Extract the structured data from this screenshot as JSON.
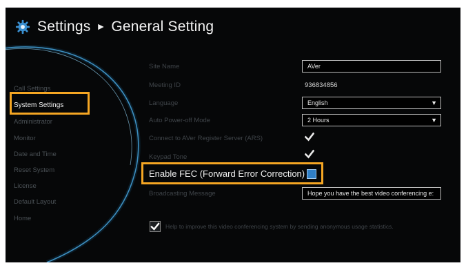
{
  "header": {
    "app_title": "Settings",
    "separator": "►",
    "page_title": "General Setting"
  },
  "sidebar": {
    "items": [
      {
        "label": "Call Settings"
      },
      {
        "label": "System Settings"
      },
      {
        "label": "Administrator"
      },
      {
        "label": "Monitor"
      },
      {
        "label": "Date and Time"
      },
      {
        "label": "Reset System"
      },
      {
        "label": "License"
      },
      {
        "label": "Default Layout"
      },
      {
        "label": "Home"
      }
    ],
    "selected_index": 1
  },
  "settings": {
    "site_name": {
      "label": "Site Name",
      "value": "AVer"
    },
    "meeting_id": {
      "label": "Meeting ID",
      "value": "936834856"
    },
    "language": {
      "label": "Language",
      "value": "English"
    },
    "auto_power_off": {
      "label": "Auto Power-off Mode",
      "value": "2 Hours"
    },
    "connect_ars": {
      "label": "Connect to AVer Register Server (ARS)",
      "checked": true
    },
    "keypad_tone": {
      "label": "Keypad Tone",
      "checked": true
    },
    "enable_fec": {
      "label": "Enable FEC (Forward Error Correction)",
      "checked": true
    },
    "broadcasting_message": {
      "label": "Broadcasting Message",
      "value": "Hope you have the best video conferencing e:"
    },
    "usage_statistics": {
      "label": "Help to improve this video conferencing system by sending anonymous usage statistics.",
      "checked": true
    }
  },
  "colors": {
    "highlight": "#f5a623",
    "background": "#060708",
    "accent_blue": "#2f7fc7"
  },
  "icons": {
    "title": "gear-icon",
    "dropdown": "triangle-down-icon",
    "checkmark": "checkmark-icon"
  }
}
